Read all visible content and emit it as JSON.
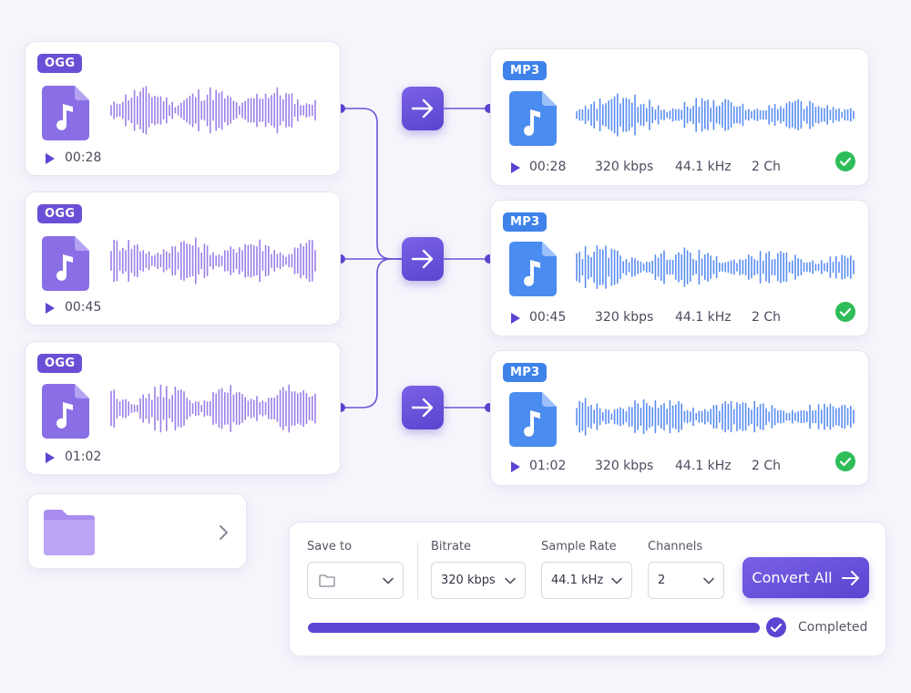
{
  "colors": {
    "ogg_accent": "#6a4fd6",
    "mp3_accent": "#3e82ea",
    "ogg_wave": "#9b7fe8",
    "mp3_wave": "#5a8ef0",
    "success": "#2ebd59",
    "primary": "#5b45d2"
  },
  "inputs": [
    {
      "format": "OGG",
      "duration": "00:28"
    },
    {
      "format": "OGG",
      "duration": "00:45"
    },
    {
      "format": "OGG",
      "duration": "01:02"
    }
  ],
  "outputs": [
    {
      "format": "MP3",
      "duration": "00:28",
      "bitrate": "320 kbps",
      "sample_rate": "44.1 kHz",
      "channels": "2 Ch",
      "status": "done"
    },
    {
      "format": "MP3",
      "duration": "00:45",
      "bitrate": "320 kbps",
      "sample_rate": "44.1 kHz",
      "channels": "2 Ch",
      "status": "done"
    },
    {
      "format": "MP3",
      "duration": "01:02",
      "bitrate": "320 kbps",
      "sample_rate": "44.1 kHz",
      "channels": "2 Ch",
      "status": "done"
    }
  ],
  "folder_card": {
    "icon": "folder-icon"
  },
  "settings": {
    "save_to_label": "Save to",
    "bitrate_label": "Bitrate",
    "bitrate_value": "320 kbps",
    "sample_rate_label": "Sample Rate",
    "sample_rate_value": "44.1 kHz",
    "channels_label": "Channels",
    "channels_value": "2",
    "convert_label": "Convert All",
    "progress": 1.0,
    "status_text": "Completed"
  }
}
